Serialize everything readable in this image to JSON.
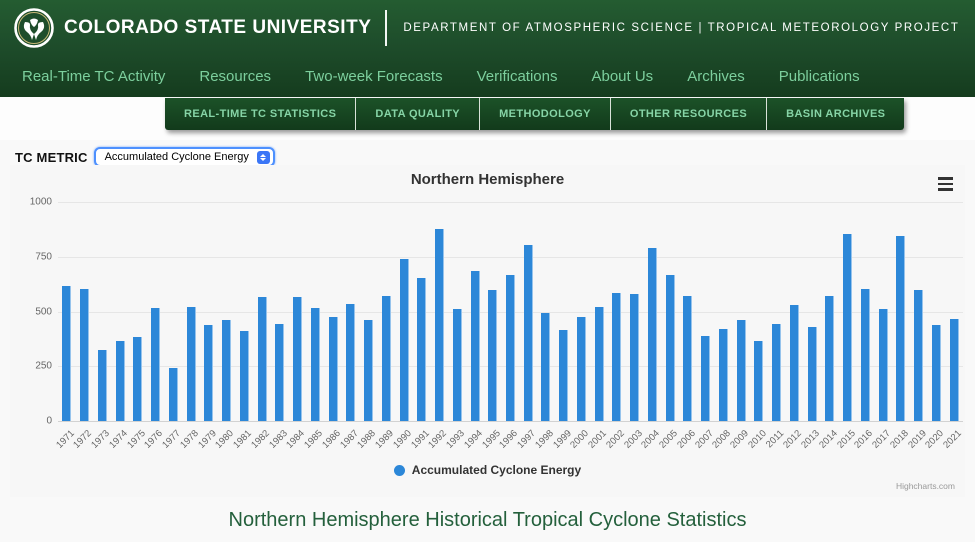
{
  "header": {
    "university": "COLORADO STATE UNIVERSITY",
    "department": "DEPARTMENT OF ATMOSPHERIC SCIENCE | TROPICAL METEOROLOGY PROJECT"
  },
  "nav": {
    "items": [
      {
        "label": "Real-Time TC Activity"
      },
      {
        "label": "Resources"
      },
      {
        "label": "Two-week Forecasts"
      },
      {
        "label": "Verifications"
      },
      {
        "label": "About Us"
      },
      {
        "label": "Archives"
      },
      {
        "label": "Publications"
      }
    ]
  },
  "tabs": {
    "items": [
      {
        "label": "REAL-TIME TC STATISTICS"
      },
      {
        "label": "DATA QUALITY"
      },
      {
        "label": "METHODOLOGY"
      },
      {
        "label": "OTHER RESOURCES"
      },
      {
        "label": "BASIN ARCHIVES"
      }
    ]
  },
  "controls": {
    "metric_label": "TC METRIC",
    "metric_value": "Accumulated Cyclone Energy"
  },
  "chart": {
    "title": "Northern Hemisphere",
    "legend_label": "Accumulated Cyclone Energy",
    "credit": "Highcharts.com",
    "menu_icon": "hamburger-icon"
  },
  "chart_data": {
    "type": "bar",
    "title": "Northern Hemisphere",
    "xlabel": "",
    "ylabel": "",
    "ylim": [
      0,
      1000
    ],
    "yticks": [
      0,
      250,
      500,
      750,
      1000
    ],
    "grid": true,
    "legend_position": "bottom",
    "bar_color": "#2c87d8",
    "categories": [
      1971,
      1972,
      1973,
      1974,
      1975,
      1976,
      1977,
      1978,
      1979,
      1980,
      1981,
      1982,
      1983,
      1984,
      1985,
      1986,
      1987,
      1988,
      1989,
      1990,
      1991,
      1992,
      1993,
      1994,
      1995,
      1996,
      1997,
      1998,
      1999,
      2000,
      2001,
      2002,
      2003,
      2004,
      2005,
      2006,
      2007,
      2008,
      2009,
      2010,
      2011,
      2012,
      2013,
      2014,
      2015,
      2016,
      2017,
      2018,
      2019,
      2020,
      2021
    ],
    "series": [
      {
        "name": "Accumulated Cyclone Energy",
        "values": [
          618,
          602,
          323,
          364,
          385,
          514,
          243,
          521,
          439,
          461,
          412,
          564,
          445,
          568,
          518,
          477,
          533,
          459,
          572,
          741,
          651,
          878,
          512,
          686,
          598,
          667,
          805,
          491,
          416,
          473,
          521,
          583,
          580,
          788,
          666,
          569,
          390,
          422,
          462,
          367,
          442,
          532,
          428,
          572,
          853,
          602,
          512,
          846,
          600,
          437,
          467
        ]
      }
    ]
  },
  "footer": {
    "title": "Northern Hemisphere Historical Tropical Cyclone Statistics"
  },
  "colors": {
    "csu_green": "#1e4d2b",
    "nav_link_green": "#7ccf9d",
    "tab_text_green": "#86d4a6",
    "bar_blue": "#2c87d8",
    "footer_green": "#24603c",
    "select_focus_blue": "#4d90fe"
  }
}
